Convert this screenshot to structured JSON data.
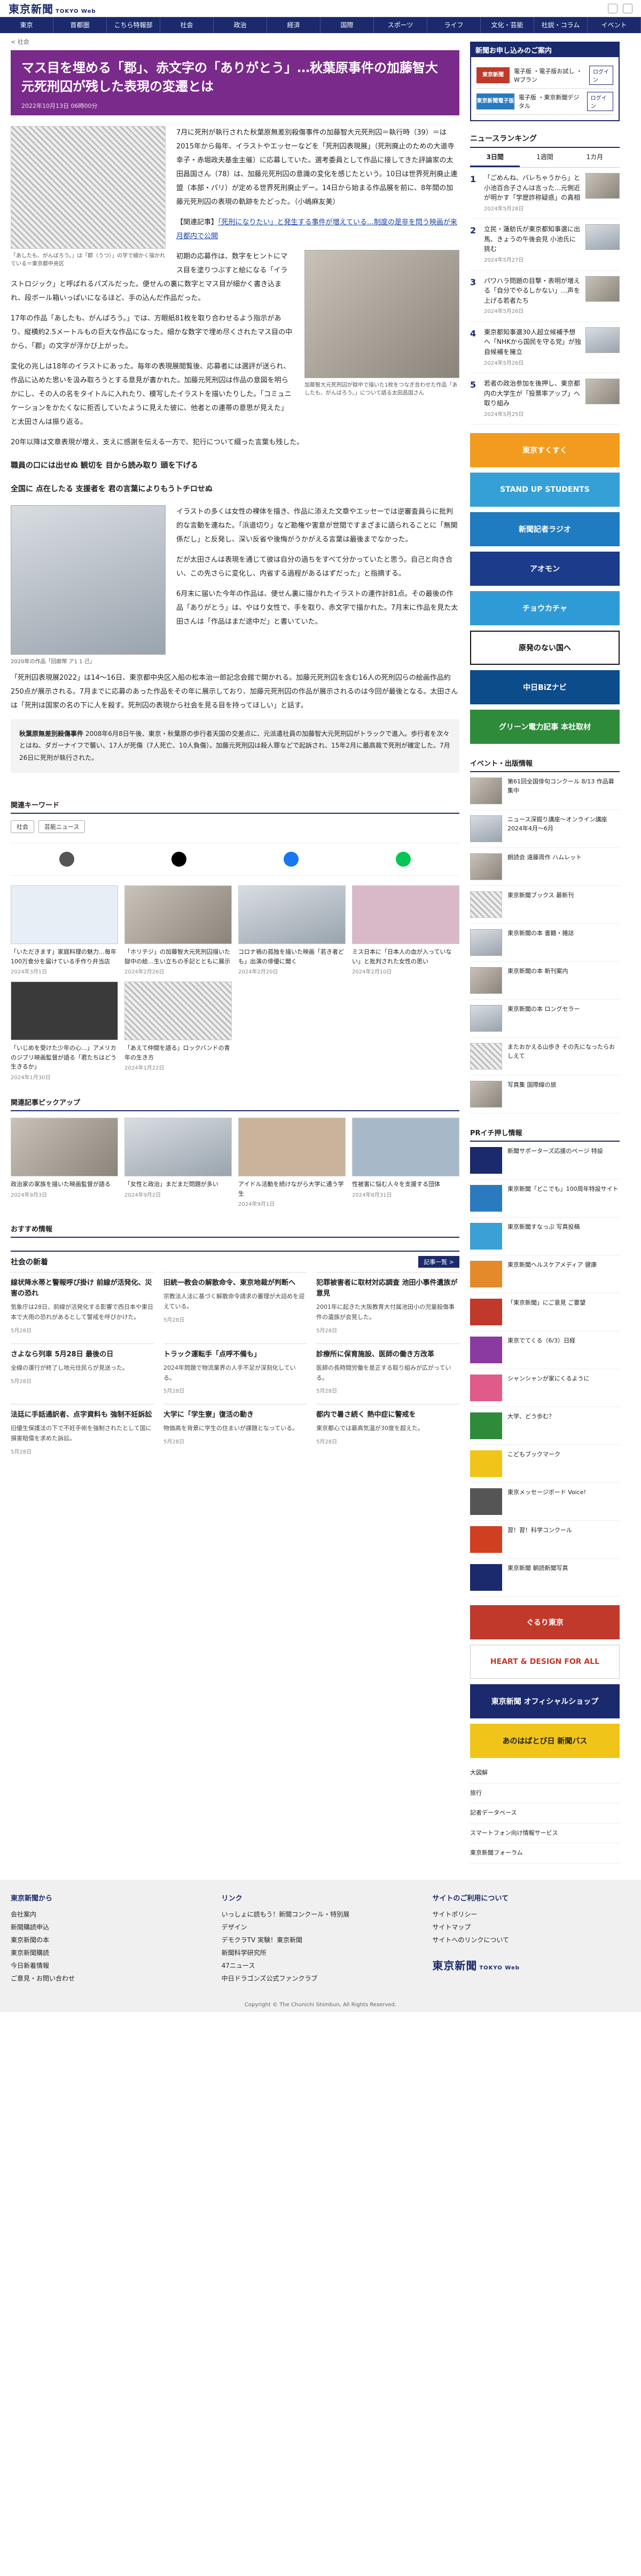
{
  "header": {
    "logo": "東京新聞",
    "logo_sub": "TOKYO Web"
  },
  "nav": [
    "東京",
    "首都圏",
    "こちら特報部",
    "社会",
    "政治",
    "経済",
    "国際",
    "スポーツ",
    "ライフ",
    "文化・芸能",
    "社説・コラム",
    "イベント"
  ],
  "breadcrumb": "< 社会",
  "article": {
    "title": "マス目を埋める「郡」、赤文字の「ありがとう」…秋葉原事件の加藤智大元死刑囚が残した表現の変遷とは",
    "date": "2022年10月13日 06時00分",
    "fig1_caption": "「あしたも、がんばろう。」は「郡（うつ）」の字で細かく描かれている＝東京都中央区",
    "p1": "7月に死刑が執行された秋葉原無差別殺傷事件の加藤智大元死刑囚＝執行時（39）＝は2015年から毎年、イラストやエッセーなどを「死刑囚表現展」（死刑廃止のための大道寺幸子・赤堀政夫基金主催）に応募していた。選考委員として作品に接してきた評論家の太田昌国さん（78）は、加藤元死刑囚の意識の変化を感じたという。10日は世界死刑廃止連盟（本部・パリ）が定める世界死刑廃止デー。14日から始まる作品展を前に、8年間の加藤元死刑囚の表現の軌跡をたどった。（小嶋麻友美）",
    "related_label": "【関連記事】",
    "related_link": "「死刑になりたい」と発生する事件が増えている…制度の是非を問う映画が来月都内で公開",
    "fig2_caption": "加藤智大元死刑囚が獄中で描いた1枚をつなぎ合わせた作品「あしたも、がんばろう。」について語る太田昌国さん",
    "p2": "初期の応募作は、数字をヒントにマス目を塗りつぶすと絵になる「イラストロジック」と呼ばれるパズルだった。便せんの裏に数字とマス目が細かく書き込まれ、段ボール箱いっぱいになるほど、手の込んだ作品だった。",
    "p3": "17年の作品「あしたも、がんばろう。」では、方眼紙81枚を取り合わせるよう指示があり、縦横約2.5メートルもの巨大な作品になった。細かな数字で埋め尽くされたマス目の中から、「郡」の文字が浮かび上がった。",
    "p4": "変化の兆しは18年のイラストにあった。毎年の表現展閲覧後、応募者には選評が送られ、作品に込めた思いを汲み取ろうとする意見が書かれた。加藤元死刑囚は作品の意図を明らかにし、その人の名をタイトルに入れたり、模写したイラストを描いたりした。「コミュニケーションをかたくなに拒否していたように見えた彼に、他者との連帯の意思が見えた」と太田さんは振り返る。",
    "p5": "20年以降は文章表現が増え、支えに感謝を伝える一方で、犯行について綴った言葉も残した。",
    "sub1": "職員の口には出せぬ 観切を 目から読み取り 頭を下げる",
    "sub2": "全国に 点在したる 支援者を 君の言葉によりもうトチロせぬ",
    "fig3_caption": "2020年の作品「回廊幣 ア1 1 己」",
    "p6": "イラストの多くは女性の裸体を描き、作品に添えた文章やエッセーでは逆審査員らに批判的な言動を連ねた。「浜道切り」など勘権や害意が世間ですまざまに語られることに「無関係だし」と反発し、深い反省や後悔がうかがえる言葉は最後までなかった。",
    "p7": "だが太田さんは表現を通じて彼は自分の過ちをすべて分かっていたと思う。自己と向き合い、この先さらに変化し、内省する過程があるはずだった」と指摘する。",
    "p8": "6月末に届いた今年の作品は、便せん裏に描かれたイラストの連作計81点。その最後の作品「ありがとう」は、やはり女性で、手を取り、赤文字で描かれた。7月末に作品を見た太田さんは「作品はまだ途中だ」と書いていた。",
    "p9": "「死刑囚表現展2022」は14〜16日、東京都中央区入船の松本治一郎記念会館で開かれる。加藤元死刑囚を含む16人の死刑囚らの絵画作品約250点が展示される。7月までに応募のあった作品をその年に展示しており、加藤元死刑囚の作品が展示されるのは今回が最後となる。太田さんは「死刑は国家の名の下に人を殺す。死刑囚の表現から社会を見る目を持ってほしい」と話す。",
    "info_title": "秋葉原無差別殺傷事件",
    "info_body": "2008年6月8日午後、東京・秋葉原の歩行者天国の交差点に、元派遣社員の加藤智大元死刑囚がトラックで進入。歩行者を次々とはね、ダガーナイフで襲い、17人が死傷（7人死亡、10人負傷）。加藤元死刑囚は殺人罪などで起訴され、15年2月に最高裁で死刑が確定した。7月26日に死刑が執行された。"
  },
  "keywords": {
    "heading": "関連キーワード",
    "tags": [
      "社会",
      "芸能ニュース"
    ]
  },
  "related_cards": [
    {
      "text": "「いただきます」家庭料理の魅力…毎年100万食分を届けている手作り弁当店",
      "date": "2024年3月1日"
    },
    {
      "text": "「ホリテジ」の加藤智大元死刑囚描いた獄中の絵…生い立ちの手記とともに展示",
      "date": "2024年2月26日"
    },
    {
      "text": "コロナ禍の孤独を描いた映画「若き者ども」出演の俳優に聞く",
      "date": "2024年2月20日"
    },
    {
      "text": "ミス日本に「日本人の血が入っていない」と批判された女性の思い",
      "date": "2024年2月10日"
    },
    {
      "text": "「いじめを受けた少年の心…」アメリカのジブリ映画監督が語る「君たちはどう生きるか」",
      "date": "2024年1月30日"
    },
    {
      "text": "「あえて仲間を語る」ロックバンドの青年の生き方",
      "date": "2024年1月22日"
    },
    {
      "text": "",
      "date": ""
    },
    {
      "text": "",
      "date": ""
    }
  ],
  "pickup": {
    "heading": "関連記事ピックアップ",
    "cards": [
      {
        "text": "政治家の家族を描いた映画監督が語る",
        "date": "2024年9月3日"
      },
      {
        "text": "「女性と政治」まだまだ問題が多い",
        "date": "2024年9月2日"
      },
      {
        "text": "アイドル活動を続けながら大学に通う学生",
        "date": "2024年9月1日"
      },
      {
        "text": "性被害に悩む人々を支援する団体",
        "date": "2024年8月31日"
      }
    ]
  },
  "recommend_heading": "おすすめ情報",
  "society_news": {
    "heading": "社会の新着",
    "more": "記事一覧 >",
    "items": [
      {
        "title": "線状降水帯と警報呼び掛け 前線が活発化、災害の恐れ",
        "body": "気象庁は28日、前線が活発化する影響で西日本や東日本で大雨の恐れがあるとして警戒を呼びかけた。",
        "date": "5月28日"
      },
      {
        "title": "旧統一教会の解散命令、東京地裁が判断へ",
        "body": "宗教法人法に基づく解散命令請求の審理が大詰めを迎えている。",
        "date": "5月28日"
      },
      {
        "title": "犯罪被害者に取材対応調査 池田小事件遺族が意見",
        "body": "2001年に起きた大阪教育大付属池田小の児童殺傷事件の遺族が会見した。",
        "date": "5月28日"
      },
      {
        "title": "さよなら列車 5月28日 最後の日",
        "body": "全線の運行が終了し地元住民らが見送った。",
        "date": "5月28日"
      },
      {
        "title": "トラック運転手「点呼不備も」",
        "body": "2024年問題で物流業界の人手不足が深刻化している。",
        "date": "5月28日"
      },
      {
        "title": "診療所に保育施設、医師の働き方改革",
        "body": "医師の長時間労働を是正する取り組みが広がっている。",
        "date": "5月28日"
      },
      {
        "title": "法廷に手話通訳者、点字資料も 強制不妊訴訟",
        "body": "旧優生保護法の下で不妊手術を強制されたとして国に損害賠償を求めた訴訟。",
        "date": "5月28日"
      },
      {
        "title": "大学に「学生寮」復活の動き",
        "body": "物価高を背景に学生の住まいが課題となっている。",
        "date": "5月28日"
      },
      {
        "title": "都内で暑さ続く 熱中症に警戒を",
        "body": "東京都心では最高気温が30度を超えた。",
        "date": "5月28日"
      }
    ]
  },
  "side": {
    "subscribe_heading": "新聞お申し込みのご案内",
    "sub_rows": [
      {
        "logo": "東京新聞",
        "text": "電子版 ・電子版お試し ・Wプラン",
        "btn": "ログイン"
      },
      {
        "logo": "東京新聞電子版",
        "text": "電子版 ・東京新聞デジタル",
        "btn": "ログイン"
      }
    ],
    "ranking_heading": "ニュースランキング",
    "ranking_tabs": [
      "3日間",
      "1週間",
      "1カ月"
    ],
    "ranking": [
      {
        "no": "1",
        "text": "「ごめんね、バレちゃうから」と小池百合子さんは言った…元側近が明かす「学歴詐称疑惑」の真相",
        "date": "2024年5月28日"
      },
      {
        "no": "2",
        "text": "立民・蓮舫氏が東京都知事選に出馬、きょうの午後会見 小池氏に挑む",
        "date": "2024年5月27日"
      },
      {
        "no": "3",
        "text": "パワハラ問題の目撃・表明が増える「自分でやるしかない」…声を上げる若者たち",
        "date": "2024年5月26日"
      },
      {
        "no": "4",
        "text": "東京都知事選30人超立候補予想へ「NHKから国民を守る党」が独自候補を擁立",
        "date": "2024年5月26日"
      },
      {
        "no": "5",
        "text": "若者の政治参加を後押し、東京都内の大学生が「投票率アップ」へ取り組み",
        "date": "2024年5月25日"
      }
    ],
    "banners": [
      {
        "label": "東京すくすく",
        "color": "#f29b1e"
      },
      {
        "label": "STAND UP STUDENTS",
        "color": "#35a0d6"
      },
      {
        "label": "新聞記者ラジオ",
        "color": "#1f7cc0"
      },
      {
        "label": "アオモン",
        "color": "#1a3c8a"
      },
      {
        "label": "チョウカチャ",
        "color": "#2f9bd6"
      },
      {
        "label": "原発のない国へ",
        "color": "#ffffff"
      },
      {
        "label": "中日BiZナビ",
        "color": "#0c4c8a"
      },
      {
        "label": "グリーン電力記事 本社取材",
        "color": "#2e8b3a"
      }
    ],
    "events_heading": "イベント・出版情報",
    "events": [
      {
        "text": "第61回全国俳句コンクール 8/13 作品募集中"
      },
      {
        "text": "ニュース深掘り講座～オンライン講座 2024年4月～6月"
      },
      {
        "text": "朗読会 遠藤周作 ハムレット"
      },
      {
        "text": "東京新聞ブックス 最新刊"
      },
      {
        "text": "東京新聞の本 書籍・雑誌"
      },
      {
        "text": "東京新聞の本 新刊案内"
      },
      {
        "text": "東京新聞の本 ロングセラー"
      },
      {
        "text": "またおかえる山歩き その先になったらおしえて"
      },
      {
        "text": "写真集 国際線の旅"
      }
    ],
    "pr_heading": "PRイチ押し情報",
    "pr": [
      {
        "text": "新聞サポーターズ応援のページ 特設"
      },
      {
        "text": "東京新聞「どこでも」100周年特設サイト"
      },
      {
        "text": "東京新聞すなっぷ 写真投稿"
      },
      {
        "text": "東京新聞ヘルスケアメディア 健康"
      },
      {
        "text": "「東京新聞」にご意見 ご要望"
      },
      {
        "text": "東京でてくる（6/3）日経"
      },
      {
        "text": "シャンシャンが家にくるように"
      },
      {
        "text": "大学、どう歩む？"
      },
      {
        "text": "こどもブックマーク"
      },
      {
        "text": "東京メッセージボード Voice!"
      },
      {
        "text": "習！習！科学コンクール"
      },
      {
        "text": "東京新聞 朝読新聞写真"
      }
    ],
    "ad_banners": [
      {
        "label": "ぐるり東京",
        "color": "#c0392b"
      },
      {
        "label": "HEART & DESIGN FOR ALL",
        "color": "#ffffff"
      },
      {
        "label": "東京新聞 オフィシャルショップ",
        "color": "#1a2a6c"
      },
      {
        "label": "あのはばとび日 新聞バス",
        "color": "#f0c419"
      }
    ],
    "more_links": [
      "大図解",
      "旅行",
      "記者データベース",
      "スマートフォン向け情報サービス",
      "東京新聞フォーラム"
    ]
  },
  "footer": {
    "col1_title": "東京新聞から",
    "col1": [
      "会社案内",
      "新聞購読申込",
      "東京新聞の本",
      "東京新聞購読",
      "今日新着情報",
      "ご意見・お問い合わせ"
    ],
    "col2_title": "リンク",
    "col2": [
      "いっしょに読もう！新聞コンクール・特別展",
      "デザイン",
      "デモクラTV 実験！東京新聞",
      "新聞科学研究所",
      "47ニュース",
      "中日ドラゴンズ公式ファンクラブ"
    ],
    "col3_title": "サイトのご利用について",
    "col3": [
      "サイトポリシー",
      "サイトマップ",
      "サイトへのリンクについて"
    ],
    "copyright": "Copyright © The Chunichi Shimbun, All Rights Reserved."
  }
}
